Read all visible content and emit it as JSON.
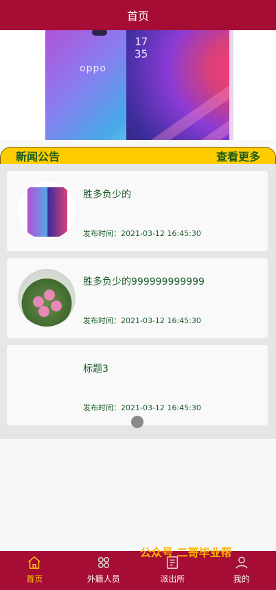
{
  "header": {
    "title": "首页"
  },
  "banner": {
    "phone_brand": "oppo",
    "phone_clock": "17\n35",
    "pagination": {
      "count": 2,
      "active": 0
    }
  },
  "section": {
    "title": "新闻公告",
    "more_label": "查看更多"
  },
  "news": [
    {
      "title": "胜多负少的",
      "time": "发布时间：2021-03-12 16:45:30",
      "thumb": "phone-image"
    },
    {
      "title": "胜多负少的999999999999",
      "time": "发布时间：2021-03-12 16:45:30",
      "thumb": "flower-image"
    },
    {
      "title": "标题3",
      "time": "发布时间：2021-03-12 16:45:30",
      "thumb": "none"
    }
  ],
  "watermark": "公众号 二哥毕业帮",
  "tabbar": [
    {
      "label": "首页",
      "icon": "home-icon",
      "active": true
    },
    {
      "label": "外籍人员",
      "icon": "grid-icon",
      "active": false
    },
    {
      "label": "派出所",
      "icon": "document-icon",
      "active": false
    },
    {
      "label": "我的",
      "icon": "user-icon",
      "active": false
    }
  ],
  "colors": {
    "primary": "#a50d35",
    "accent": "#ffcc00",
    "text_green": "#1a5a2a"
  }
}
